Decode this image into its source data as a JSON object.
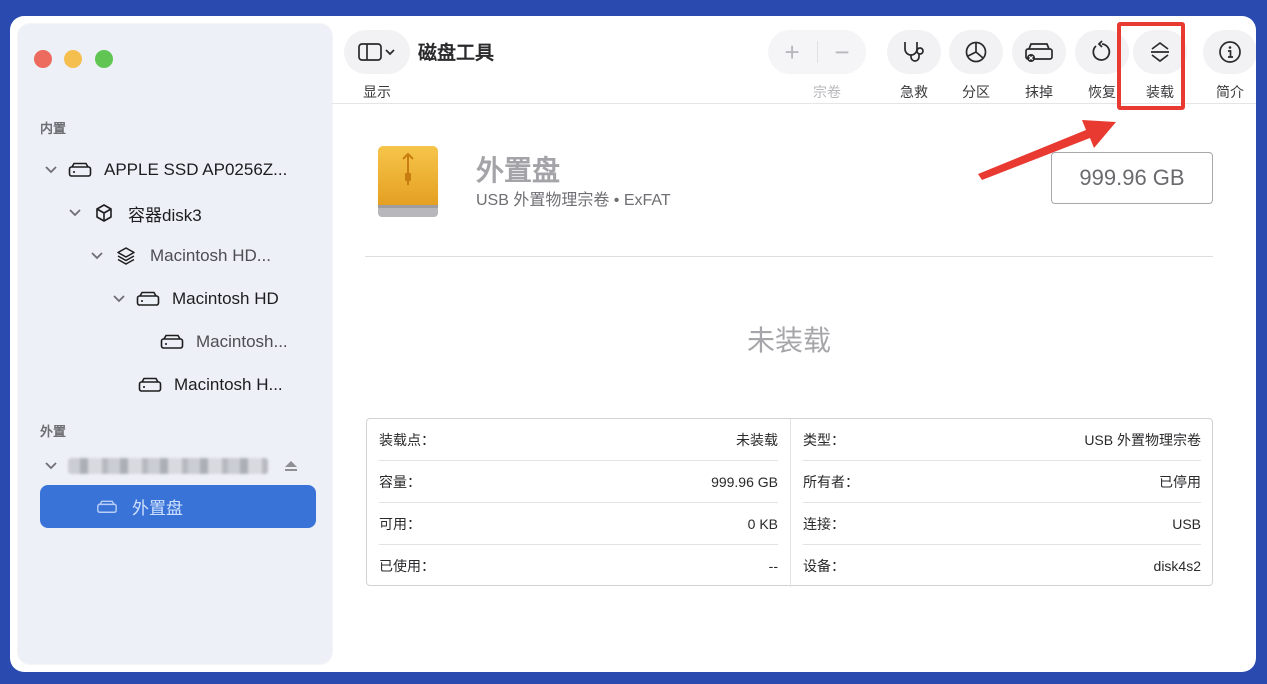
{
  "app": {
    "title": "磁盘工具"
  },
  "toolbar": {
    "view_label": "显示",
    "volume_label": "宗卷",
    "add_symbol": "+",
    "remove_symbol": "−",
    "first_aid": "急救",
    "partition": "分区",
    "erase": "抹掉",
    "restore": "恢复",
    "mount": "装载",
    "info": "简介"
  },
  "sidebar": {
    "internal_header": "内置",
    "external_header": "外置",
    "items": [
      {
        "label": "APPLE SSD AP0256Z...",
        "icon": "drive-icon"
      },
      {
        "label": "容器disk3",
        "icon": "container-icon"
      },
      {
        "label": "Macintosh HD...",
        "icon": "layers-icon"
      },
      {
        "label": "Macintosh HD",
        "icon": "drive-icon"
      },
      {
        "label": "Macintosh...",
        "icon": "drive-icon"
      },
      {
        "label": "Macintosh H...",
        "icon": "drive-icon"
      }
    ],
    "selected": {
      "label": "外置盘",
      "icon": "drive-icon"
    }
  },
  "volume": {
    "name": "外置盘",
    "subtitle": "USB 外置物理宗卷 • ExFAT",
    "size": "999.96 GB",
    "status": "未装载"
  },
  "info": {
    "left": [
      {
        "key": "装载点：",
        "value": "未装载"
      },
      {
        "key": "容量：",
        "value": "999.96 GB"
      },
      {
        "key": "可用：",
        "value": "0 KB"
      },
      {
        "key": "已使用：",
        "value": "--"
      }
    ],
    "right": [
      {
        "key": "类型：",
        "value": "USB 外置物理宗卷"
      },
      {
        "key": "所有者：",
        "value": "已停用"
      },
      {
        "key": "连接：",
        "value": "USB"
      },
      {
        "key": "设备：",
        "value": "disk4s2"
      }
    ]
  },
  "colors": {
    "accent": "#3a73d8",
    "annotation": "#e83a30",
    "disk_orange": "#f0b429"
  }
}
